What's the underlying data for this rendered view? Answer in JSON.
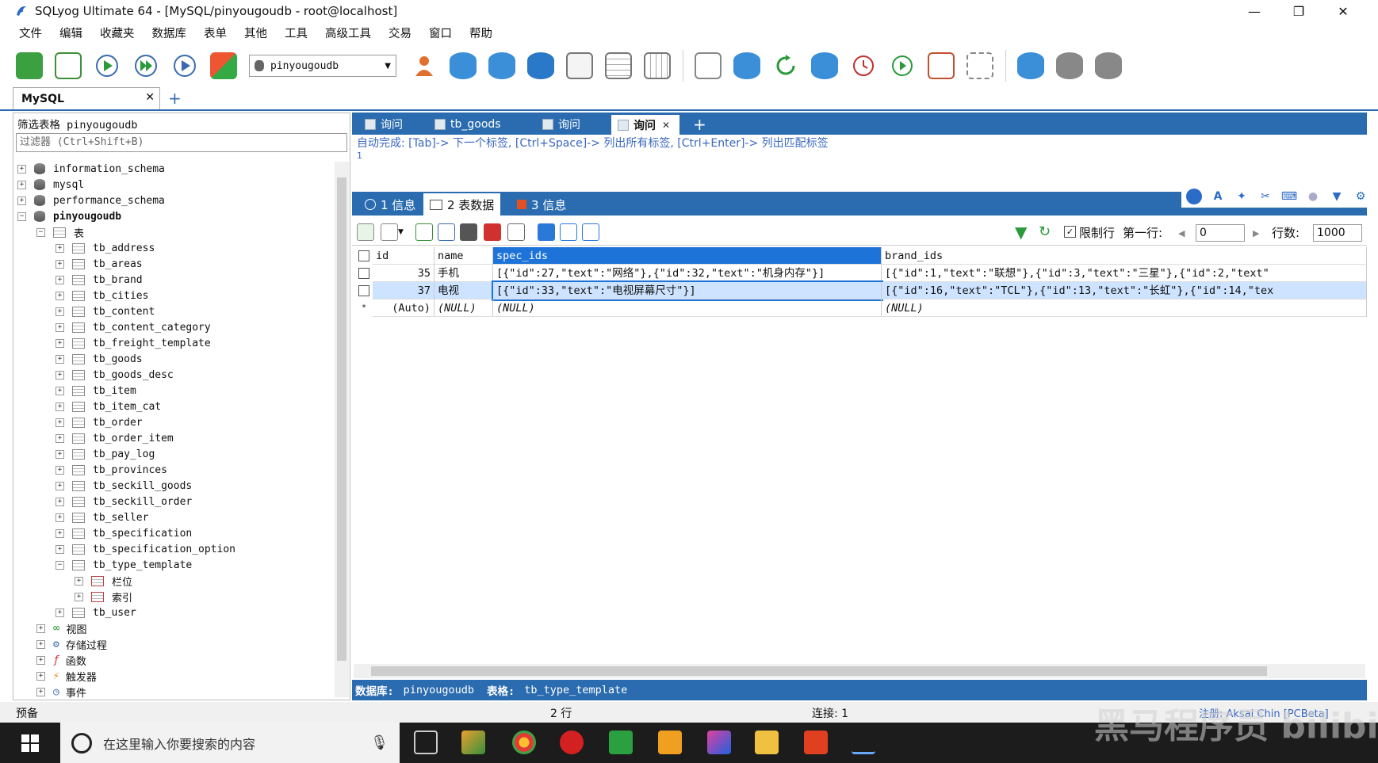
{
  "window": {
    "title": "SQLyog Ultimate 64 - [MySQL/pinyougoudb - root@localhost]",
    "minimize": "—",
    "restore": "❐",
    "close": "✕"
  },
  "menu": [
    "文件",
    "编辑",
    "收藏夹",
    "数据库",
    "表单",
    "其他",
    "工具",
    "高级工具",
    "交易",
    "窗口",
    "帮助"
  ],
  "toolbar": {
    "db_select": "pinyougoudb"
  },
  "connection_tab": {
    "label": "MySQL",
    "close": "✕",
    "add": "+"
  },
  "left": {
    "filter_label": "筛选表格 pinyougoudb",
    "filter_placeholder": "过滤器 (Ctrl+Shift+B)",
    "databases": [
      "information_schema",
      "mysql",
      "performance_schema",
      "pinyougoudb"
    ],
    "tables_folder": "表",
    "tables": [
      "tb_address",
      "tb_areas",
      "tb_brand",
      "tb_cities",
      "tb_content",
      "tb_content_category",
      "tb_freight_template",
      "tb_goods",
      "tb_goods_desc",
      "tb_item",
      "tb_item_cat",
      "tb_order",
      "tb_order_item",
      "tb_pay_log",
      "tb_provinces",
      "tb_seckill_goods",
      "tb_seckill_order",
      "tb_seller",
      "tb_specification",
      "tb_specification_option",
      "tb_type_template"
    ],
    "expanded_children": [
      "栏位",
      "索引"
    ],
    "after_tables": [
      "tb_user"
    ],
    "other_folders": [
      "视图",
      "存储过程",
      "函数",
      "触发器",
      "事件"
    ]
  },
  "query_tabs": [
    {
      "label": "询问",
      "active": false
    },
    {
      "label": "tb_goods",
      "active": false
    },
    {
      "label": "询问",
      "active": false
    },
    {
      "label": "询问",
      "active": true
    }
  ],
  "query_tab_close": "✕",
  "query_tab_add": "+",
  "editor": {
    "hint": "自动完成: [Tab]-> 下一个标签, [Ctrl+Space]-> 列出所有标签, [Ctrl+Enter]-> 列出匹配标签",
    "line_number": "1"
  },
  "result_tabs": [
    {
      "label": "1 信息",
      "active": false
    },
    {
      "label": "2 表数据",
      "active": true
    },
    {
      "label": "3 信息",
      "active": false
    }
  ],
  "grid_bar": {
    "limit_label": "限制行",
    "limit_checked": "✓",
    "first_row_label": "第一行:",
    "first_row_value": "0",
    "rows_label": "行数:",
    "rows_value": "1000",
    "prev": "◀",
    "next": "▶"
  },
  "grid": {
    "columns": [
      "id",
      "name",
      "spec_ids",
      "brand_ids"
    ],
    "rows": [
      [
        "35",
        "手机",
        "[{\"id\":27,\"text\":\"网络\"},{\"id\":32,\"text\":\"机身内存\"}]",
        "[{\"id\":1,\"text\":\"联想\"},{\"id\":3,\"text\":\"三星\"},{\"id\":2,\"text\""
      ],
      [
        "37",
        "电视",
        "[{\"id\":33,\"text\":\"电视屏幕尺寸\"}]",
        "[{\"id\":16,\"text\":\"TCL\"},{\"id\":13,\"text\":\"长虹\"},{\"id\":14,\"tex"
      ]
    ],
    "new_row": [
      "(Auto)",
      "(NULL)",
      "(NULL)",
      "(NULL)"
    ],
    "new_row_marker": "*"
  },
  "info_bar": {
    "db_label": "数据库:",
    "db_value": "pinyougoudb",
    "table_label": "表格:",
    "table_value": "tb_type_template"
  },
  "status": {
    "left": "预备",
    "rows": "2 行",
    "connections": "连接: 1",
    "register": "注册: Aksai Chin [PCBeta]"
  },
  "taskbar": {
    "search_placeholder": "在这里输入你要搜索的内容"
  },
  "watermark": "黑马程序员 bilibili",
  "colors": {
    "accent": "#2b6cb0",
    "selected_header": "#1e73d8",
    "row_selected": "#cde3ff",
    "hint": "#3a68c0"
  }
}
